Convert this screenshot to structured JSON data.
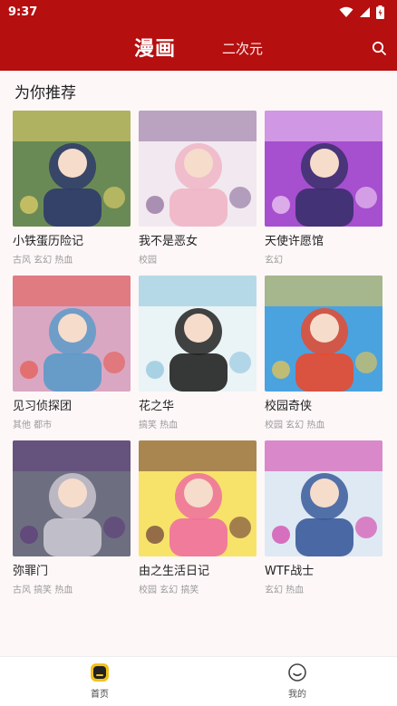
{
  "status": {
    "time": "9:37"
  },
  "header": {
    "tab_manga": "漫画",
    "tab_2d": "二次元"
  },
  "section_title": "为你推荐",
  "comics": [
    {
      "title": "小铁蛋历险记",
      "tags": "古风 玄幻 热血",
      "colors": [
        "#6a8a55",
        "#2f3a6b",
        "#e8d36a"
      ]
    },
    {
      "title": "我不是恶女",
      "tags": "校园",
      "colors": [
        "#f1e9ef",
        "#f0b5c5",
        "#8a6a9a"
      ]
    },
    {
      "title": "天使许愿馆",
      "tags": "玄幻",
      "colors": [
        "#a64fcf",
        "#3a2f6b",
        "#f3d3f5"
      ]
    },
    {
      "title": "见习侦探团",
      "tags": "其他 都市",
      "colors": [
        "#d9a7c2",
        "#5a9bc9",
        "#e5584e"
      ]
    },
    {
      "title": "花之华",
      "tags": "搞笑 热血",
      "colors": [
        "#eaf3f6",
        "#222222",
        "#8bc3dd"
      ]
    },
    {
      "title": "校园奇侠",
      "tags": "校园 玄幻 热血",
      "colors": [
        "#4aa3de",
        "#e94a2f",
        "#f2c64a"
      ]
    },
    {
      "title": "弥罪门",
      "tags": "古风 搞笑 热血",
      "colors": [
        "#6d6f80",
        "#c9c6cf",
        "#5e3b7a"
      ]
    },
    {
      "title": "由之生活日记",
      "tags": "校园 玄幻 搞笑",
      "colors": [
        "#f7e36a",
        "#ef6fa0",
        "#6a3a3a"
      ]
    },
    {
      "title": "WTF战士",
      "tags": "玄幻 热血",
      "colors": [
        "#dfe9f3",
        "#3a5a9a",
        "#d33aa8"
      ]
    }
  ],
  "bottom_nav": {
    "home": "首页",
    "mine": "我的"
  },
  "colors": {
    "brand": "#b50f0f",
    "home_icon": "#f3c21c"
  }
}
